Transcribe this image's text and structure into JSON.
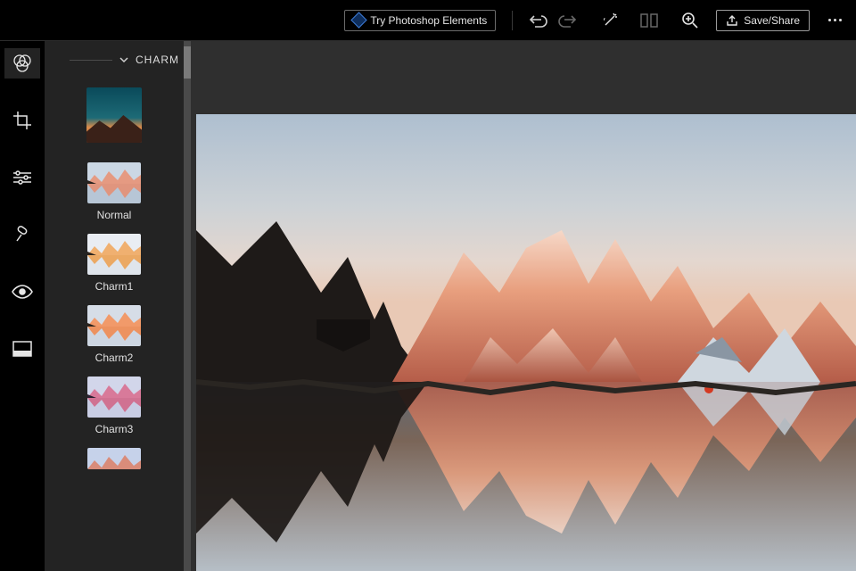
{
  "topbar": {
    "try_label": "Try Photoshop Elements",
    "save_label": "Save/Share",
    "icons": {
      "undo": "undo-icon",
      "redo": "redo-icon",
      "magic": "magic-wand-icon",
      "compare": "compare-icon",
      "zoom": "zoom-in-icon",
      "share": "share-icon",
      "more": "more-icon"
    }
  },
  "rail": {
    "tools": [
      {
        "name": "looks-icon",
        "active": true
      },
      {
        "name": "crop-icon",
        "active": false
      },
      {
        "name": "sliders-icon",
        "active": false
      },
      {
        "name": "blemish-icon",
        "active": false
      },
      {
        "name": "redeye-icon",
        "active": false
      },
      {
        "name": "frames-icon",
        "active": false
      }
    ]
  },
  "panel": {
    "group_name": "CHARM",
    "presets": [
      {
        "label": "",
        "style": "sunset-hill",
        "tall": true
      },
      {
        "label": "Normal",
        "style": "alpen-normal"
      },
      {
        "label": "Charm1",
        "style": "alpen-yellow"
      },
      {
        "label": "Charm2",
        "style": "alpen-warm"
      },
      {
        "label": "Charm3",
        "style": "alpen-violet"
      },
      {
        "label": "",
        "style": "alpen-blue",
        "partial": true
      }
    ]
  },
  "colors": {
    "panel_bg": "#232323",
    "stroke": "#6b6b6b"
  }
}
